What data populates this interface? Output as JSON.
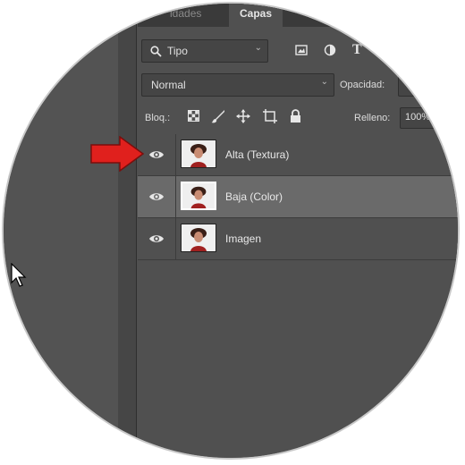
{
  "tabs": {
    "previous_partial": "idades",
    "active": "Capas"
  },
  "filter": {
    "kind_label": "Tipo",
    "icons": [
      "search-icon",
      "image-filter-icon",
      "adjustment-filter-icon",
      "type-filter-icon"
    ]
  },
  "blend": {
    "mode": "Normal",
    "opacity_label": "Opacidad:"
  },
  "lock": {
    "label": "Bloq.:",
    "icons": [
      "lock-transparent-pixels-icon",
      "lock-image-pixels-icon",
      "lock-position-icon",
      "lock-artboard-icon",
      "lock-all-icon"
    ]
  },
  "fill": {
    "label": "Relleno:",
    "value": "100%"
  },
  "layers": [
    {
      "name": "Alta (Textura)",
      "visible": true,
      "selected": false
    },
    {
      "name": "Baja (Color)",
      "visible": true,
      "selected": true
    },
    {
      "name": "Imagen",
      "visible": true,
      "selected": false
    }
  ],
  "annotation": {
    "arrow_color": "#e0201d",
    "points_to": "Alta (Textura)"
  }
}
